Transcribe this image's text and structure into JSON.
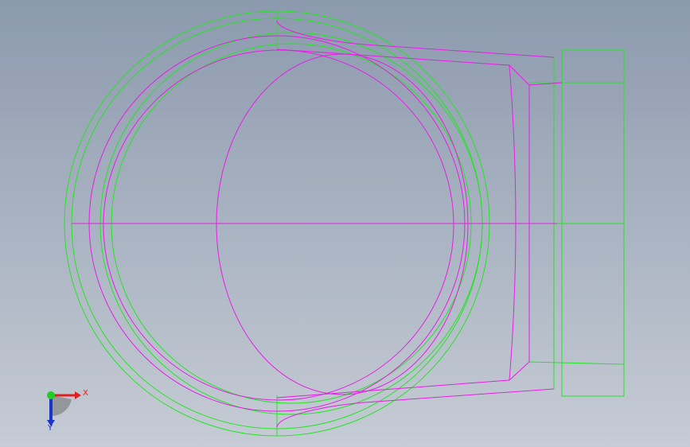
{
  "viewport": {
    "background_top": "#8c9aae",
    "background_bottom": "#c6ccd5"
  },
  "colors": {
    "edge_green": "#22e622",
    "edge_magenta": "#e61ee6",
    "axis_x": "#e02020",
    "axis_y": "#1a33c8",
    "axis_origin": "#22cc22"
  },
  "triad": {
    "x_label": "X",
    "y_label": "Y",
    "icon": "coordinate-triad-icon"
  }
}
